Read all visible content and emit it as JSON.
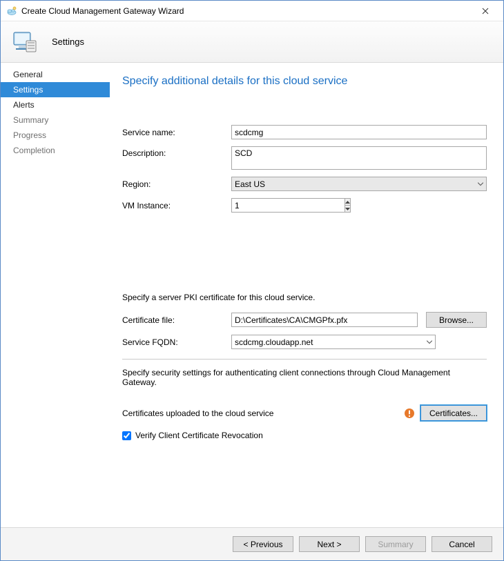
{
  "window": {
    "title": "Create Cloud Management Gateway Wizard"
  },
  "header": {
    "label": "Settings"
  },
  "sidebar": {
    "items": [
      {
        "label": "General",
        "state": "done"
      },
      {
        "label": "Settings",
        "state": "active"
      },
      {
        "label": "Alerts",
        "state": "done"
      },
      {
        "label": "Summary",
        "state": "pending"
      },
      {
        "label": "Progress",
        "state": "pending"
      },
      {
        "label": "Completion",
        "state": "pending"
      }
    ]
  },
  "page": {
    "title": "Specify additional details for this cloud service",
    "labels": {
      "service_name": "Service name:",
      "description": "Description:",
      "region": "Region:",
      "vm_instance": "VM Instance:",
      "pki_text": "Specify a server PKI certificate for this cloud service.",
      "certificate_file": "Certificate file:",
      "service_fqdn": "Service FQDN:",
      "security_text": "Specify security settings for authenticating client connections through Cloud Management Gateway.",
      "certs_uploaded": "Certificates uploaded to the cloud service",
      "verify_crl": "Verify Client Certificate Revocation"
    },
    "values": {
      "service_name": "scdcmg",
      "description": "SCD",
      "region": "East US",
      "vm_instance": "1",
      "certificate_file": "D:\\Certificates\\CA\\CMGPfx.pfx",
      "service_fqdn": "scdcmg.cloudapp.net",
      "verify_crl_checked": true
    },
    "buttons": {
      "browse": "Browse...",
      "certificates": "Certificates..."
    }
  },
  "footer": {
    "previous": "< Previous",
    "next": "Next >",
    "summary": "Summary",
    "cancel": "Cancel"
  }
}
